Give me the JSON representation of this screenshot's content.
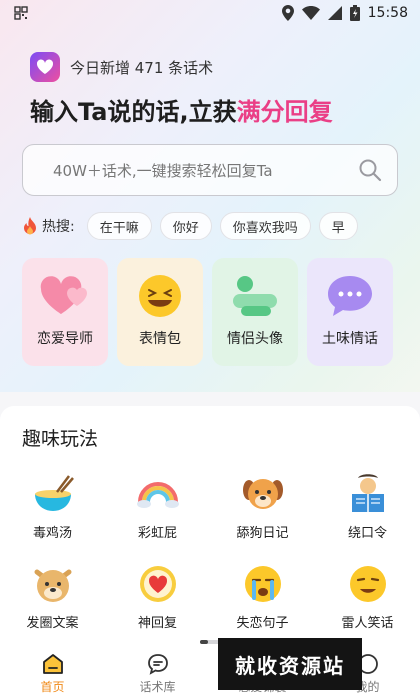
{
  "status": {
    "time": "15:58"
  },
  "header": {
    "today_text": "今日新增 471 条话术",
    "title_main": "输入Ta说的话,立获",
    "title_accent": "满分回复"
  },
  "search": {
    "placeholder": "40W＋话术,一键搜索轻松回复Ta"
  },
  "hot": {
    "label": "热搜:",
    "chips": [
      "在干嘛",
      "你好",
      "你喜欢我吗",
      "早"
    ]
  },
  "categories": [
    {
      "label": "恋爱导师",
      "icon": "hearts-icon"
    },
    {
      "label": "表情包",
      "icon": "laughing-face-icon"
    },
    {
      "label": "情侣头像",
      "icon": "chat-bubbles-icon"
    },
    {
      "label": "土味情话",
      "icon": "speech-bubble-icon"
    }
  ],
  "fun": {
    "title": "趣味玩法",
    "items": [
      {
        "label": "毒鸡汤",
        "icon": "noodle-bowl-icon"
      },
      {
        "label": "彩虹屁",
        "icon": "rainbow-icon"
      },
      {
        "label": "舔狗日记",
        "icon": "dog-icon"
      },
      {
        "label": "绕口令",
        "icon": "reading-icon"
      },
      {
        "label": "发圈文案",
        "icon": "doge-icon"
      },
      {
        "label": "神回复",
        "icon": "heart-bubble-icon"
      },
      {
        "label": "失恋句子",
        "icon": "crying-face-icon"
      },
      {
        "label": "雷人笑话",
        "icon": "smirk-face-icon"
      }
    ]
  },
  "tabs": [
    {
      "label": "首页",
      "icon": "home-icon",
      "active": true
    },
    {
      "label": "话术库",
      "icon": "chat-icon",
      "active": false
    },
    {
      "label": "恋爱锦囊",
      "icon": "tips-icon",
      "active": false
    },
    {
      "label": "我的",
      "icon": "profile-icon",
      "active": false
    }
  ],
  "watermark": {
    "text": "就收资源站"
  },
  "colors": {
    "accent": "#ea3f86",
    "tab_active": "#f08a18"
  }
}
